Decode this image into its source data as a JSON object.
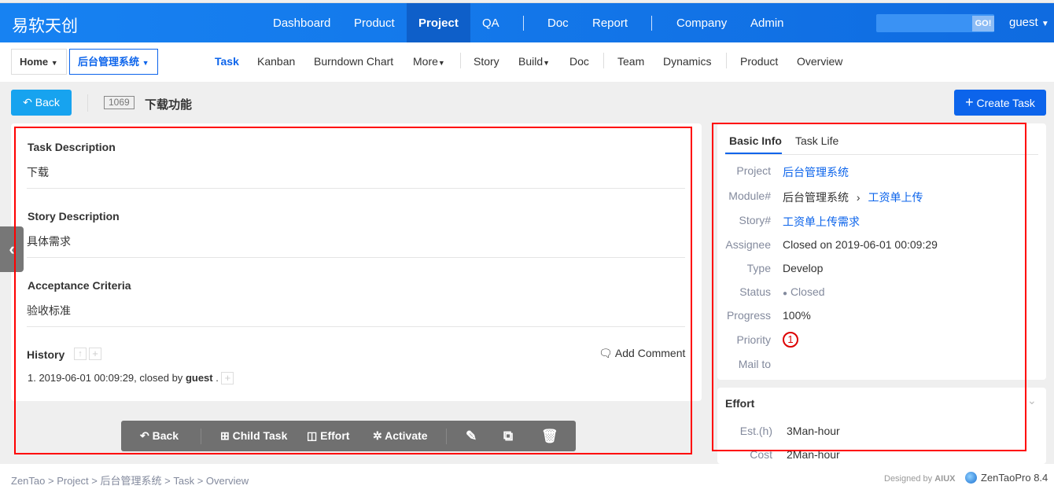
{
  "header": {
    "logo": "易软天创",
    "nav": [
      "Dashboard",
      "Product",
      "Project",
      "QA",
      "Doc",
      "Report",
      "Company",
      "Admin"
    ],
    "active": "Project",
    "search_button": "GO!",
    "user": "guest"
  },
  "subnav": {
    "home": "Home",
    "project": "后台管理系统",
    "items": [
      "Task",
      "Kanban",
      "Burndown Chart",
      "More",
      "Story",
      "Build",
      "Doc",
      "Team",
      "Dynamics",
      "Product",
      "Overview"
    ],
    "active": "Task"
  },
  "page": {
    "back": "Back",
    "task_id": "1069",
    "task_title": "下载功能",
    "create_task": "Create Task"
  },
  "main": {
    "sections": [
      {
        "title": "Task Description",
        "content": "下载"
      },
      {
        "title": "Story Description",
        "content": "具体需求"
      },
      {
        "title": "Acceptance Criteria",
        "content": "验收标准"
      }
    ],
    "history": {
      "title": "History",
      "add_comment": "Add Comment",
      "entries": [
        {
          "prefix": "1. 2019-06-01 00:09:29, closed by ",
          "user": "guest",
          "suffix": " ."
        }
      ]
    }
  },
  "toolbar": {
    "back": "Back",
    "child_task": "Child Task",
    "effort": "Effort",
    "activate": "Activate"
  },
  "basic_info": {
    "tabs": [
      "Basic Info",
      "Task Life"
    ],
    "project_label": "Project",
    "project": "后台管理系统",
    "module_label": "Module#",
    "module_parent": "后台管理系统",
    "module": "工资单上传",
    "story_label": "Story#",
    "story": "工资单上传需求",
    "assignee_label": "Assignee",
    "assignee": "Closed on 2019-06-01 00:09:29",
    "type_label": "Type",
    "type": "Develop",
    "status_label": "Status",
    "status": "Closed",
    "progress_label": "Progress",
    "progress": "100%",
    "priority_label": "Priority",
    "priority": "1",
    "mailto_label": "Mail to"
  },
  "effort": {
    "title": "Effort",
    "est_label": "Est.(h)",
    "est": "3Man-hour",
    "cost_label": "Cost",
    "cost": "2Man-hour"
  },
  "footer": {
    "breadcrumb": [
      "ZenTao",
      "Project",
      "后台管理系统",
      "Task",
      "Overview"
    ],
    "designed_by": "Designed by",
    "aiux": "AIUX",
    "version": "ZenTaoPro 8.4"
  },
  "colors": {
    "primary": "#0c64eb",
    "back_button": "#17a3ef",
    "highlight": "#ff0000"
  }
}
